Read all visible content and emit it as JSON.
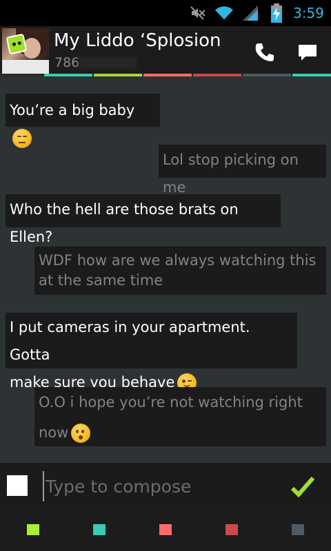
{
  "status_bar": {
    "time": "3:59",
    "icons": [
      "mute-icon",
      "wifi-icon",
      "signal-icon",
      "battery-charging-icon"
    ],
    "accent": "#33b5e5"
  },
  "header": {
    "contact_name": "My Liddo ‘Splosion",
    "contact_number": "786",
    "icons": [
      "phone-icon",
      "chat-icon"
    ]
  },
  "stripe_colors": [
    "#2a2a2a",
    "#38cbb7",
    "#a9d63b",
    "#ff6b6b",
    "#c94b4b",
    "#4c5a63",
    "#38cbb7"
  ],
  "messages": [
    {
      "direction": "incoming",
      "text": "You’re a big baby",
      "emoji": "unamused-face"
    },
    {
      "direction": "outgoing",
      "text": "Lol stop picking on me"
    },
    {
      "direction": "incoming",
      "text": "Who the hell are those brats on Ellen?"
    },
    {
      "direction": "outgoing",
      "line1": "WDF how are we always watching this",
      "line2": "at the same time"
    },
    {
      "direction": "incoming",
      "line1": "I put cameras in your apartment. Gotta",
      "line2": "make sure you behave",
      "emoji": "winking-face"
    },
    {
      "direction": "outgoing",
      "line1": "O.O i hope you’re not watching right",
      "line2": "now",
      "emoji": "hushed-face"
    }
  ],
  "compose": {
    "placeholder": "Type to compose",
    "value": ""
  },
  "palette_colors": [
    "#a9ef3a",
    "#38cbb7",
    "#ff6b6b",
    "#c94b4b",
    "#4c5a63"
  ]
}
